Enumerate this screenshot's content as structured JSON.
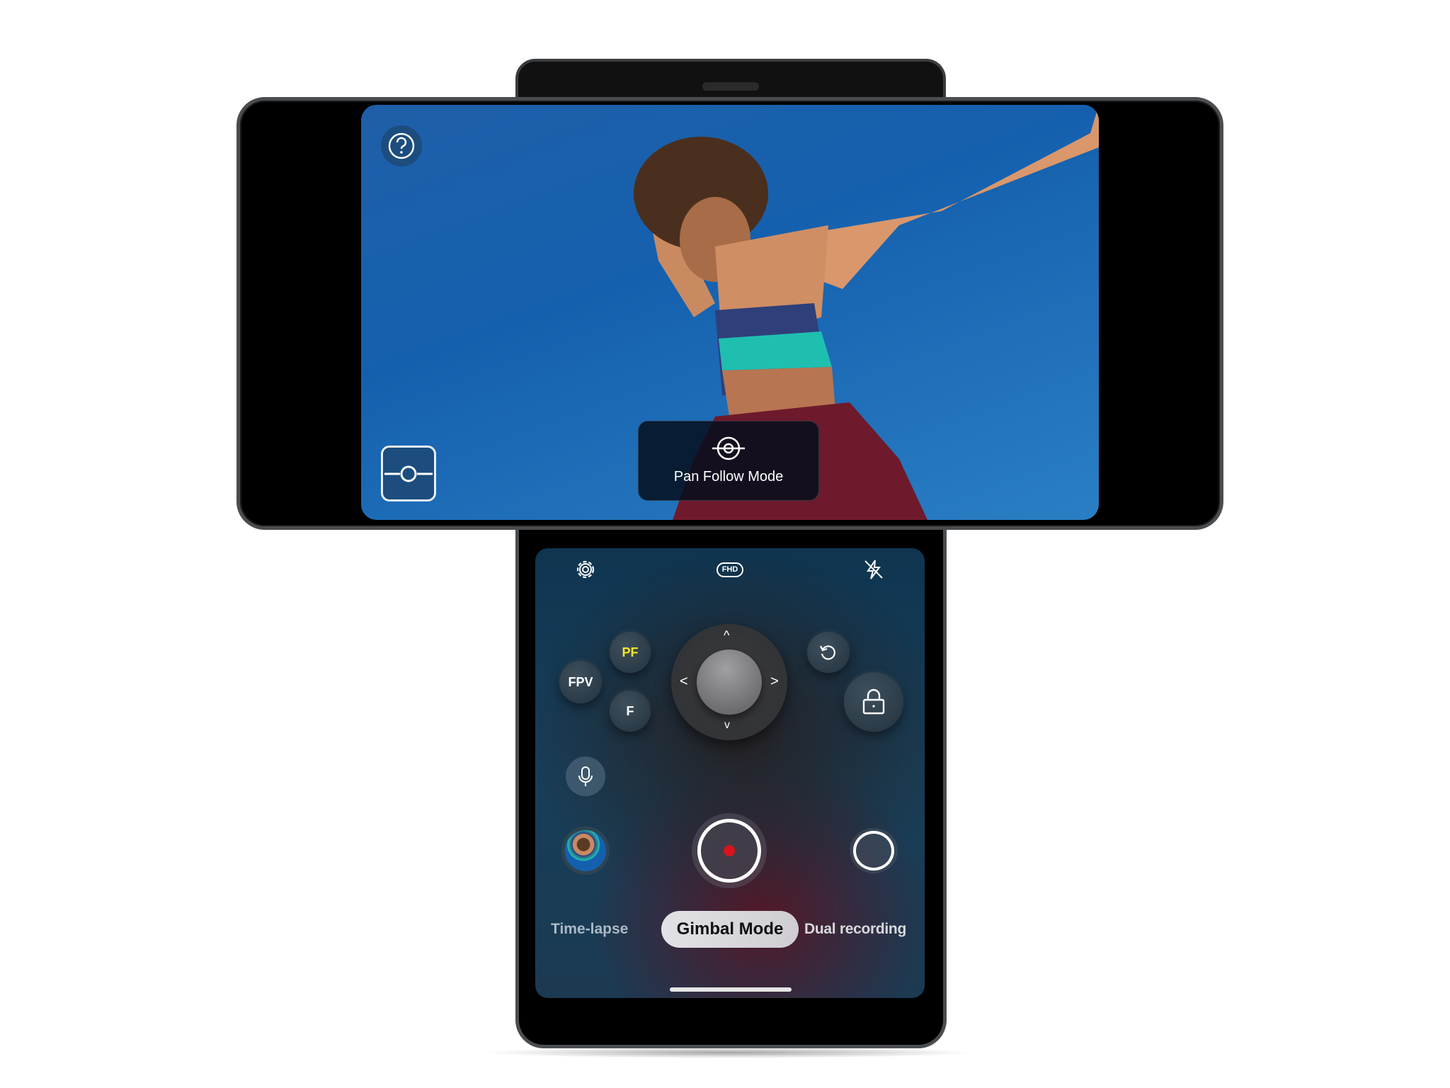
{
  "top_screen": {
    "toast": {
      "icon": "pan-follow-icon",
      "label": "Pan Follow Mode"
    },
    "help_icon": "question-circle-icon",
    "pan_mode_icon": "pan-follow-icon"
  },
  "bottom_screen": {
    "top_bar": {
      "settings_icon": "gear-icon",
      "resolution": "FHD",
      "flash_icon": "flash-off-icon"
    },
    "gimbal_buttons": {
      "pf": "PF",
      "fpv": "FPV",
      "f": "F"
    },
    "joystick": {
      "up": "^",
      "down": "v",
      "left": "<",
      "right": ">"
    },
    "rotate_icon": "rotate-icon",
    "lock_icon": "lock-icon",
    "mic_icon": "microphone-icon",
    "modes": [
      {
        "label": "Time-lapse",
        "selected": false
      },
      {
        "label": "Gimbal Mode",
        "selected": true
      },
      {
        "label": "Dual recording",
        "selected": false
      }
    ]
  },
  "colors": {
    "pf_active": "#f5e52a",
    "record_dot": "#d8141c",
    "sky": "#1560ae"
  }
}
